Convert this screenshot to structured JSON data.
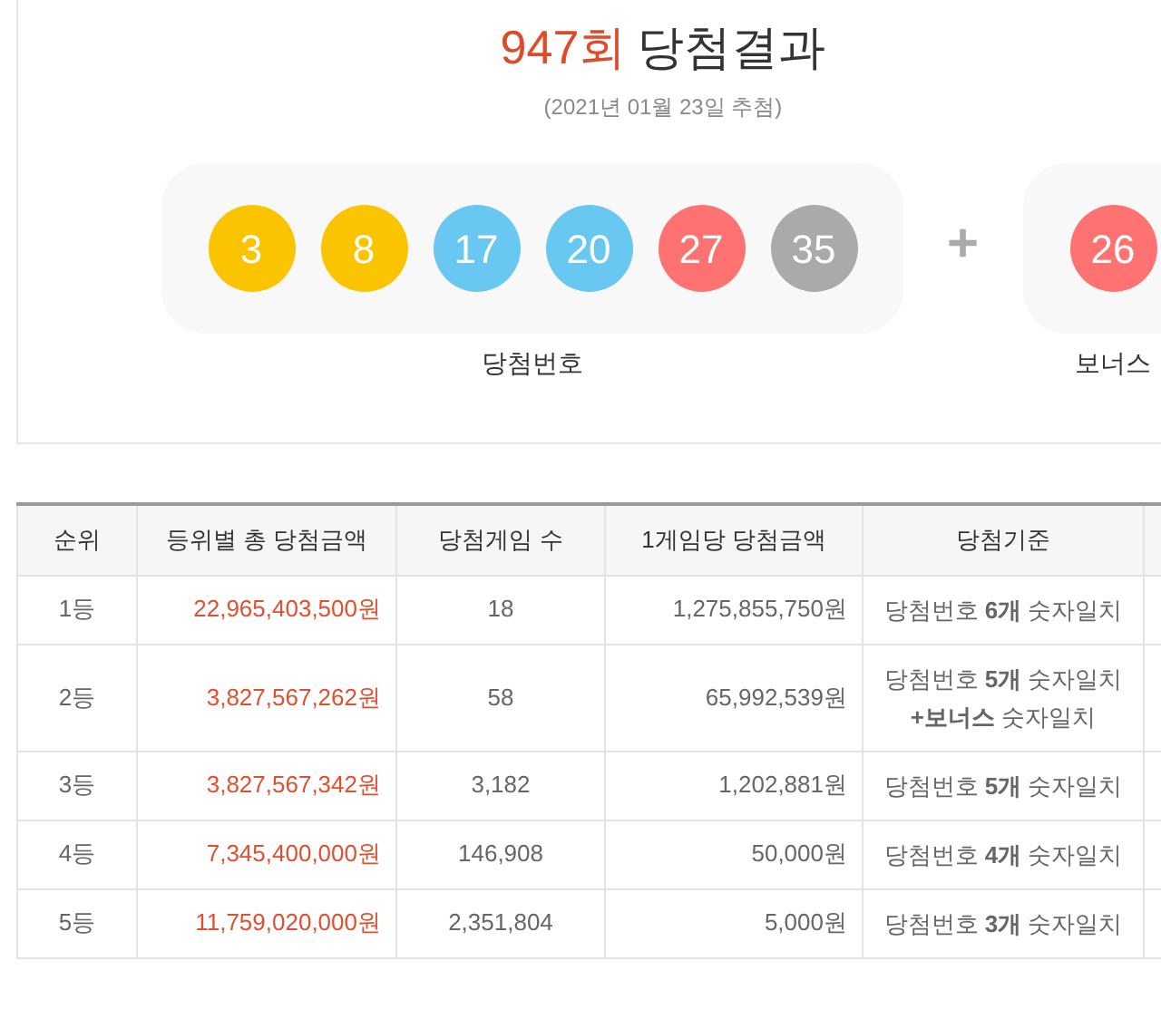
{
  "draw": {
    "round": "947회",
    "title": "당첨결과",
    "date": "(2021년 01월 23일 추첨)",
    "numbers": [
      {
        "value": "3",
        "color": "#fbc400"
      },
      {
        "value": "8",
        "color": "#fbc400"
      },
      {
        "value": "17",
        "color": "#69c8f2"
      },
      {
        "value": "20",
        "color": "#69c8f2"
      },
      {
        "value": "27",
        "color": "#ff7272"
      },
      {
        "value": "35",
        "color": "#aaaaaa"
      }
    ],
    "plus": "+",
    "bonus": {
      "value": "26",
      "color": "#ff7272"
    },
    "numbers_label": "당첨번호",
    "bonus_label": "보너스"
  },
  "table": {
    "columns": [
      "순위",
      "등위별 총 당첨금액",
      "당첨게임 수",
      "1게임당 당첨금액",
      "당첨기준"
    ],
    "rows": [
      {
        "rank": "1등",
        "total": "22,965,403,500원",
        "winners": "18",
        "per_game": "1,275,855,750원",
        "criteria": [
          "당첨번호 **6개** 숫자일치"
        ]
      },
      {
        "rank": "2등",
        "total": "3,827,567,262원",
        "winners": "58",
        "per_game": "65,992,539원",
        "criteria": [
          "당첨번호 **5개** 숫자일치",
          "**+보너스** 숫자일치"
        ]
      },
      {
        "rank": "3등",
        "total": "3,827,567,342원",
        "winners": "3,182",
        "per_game": "1,202,881원",
        "criteria": [
          "당첨번호 **5개** 숫자일치"
        ]
      },
      {
        "rank": "4등",
        "total": "7,345,400,000원",
        "winners": "146,908",
        "per_game": "50,000원",
        "criteria": [
          "당첨번호 **4개** 숫자일치"
        ]
      },
      {
        "rank": "5등",
        "total": "11,759,020,000원",
        "winners": "2,351,804",
        "per_game": "5,000원",
        "criteria": [
          "당첨번호 **3개** 숫자일치"
        ]
      }
    ]
  }
}
